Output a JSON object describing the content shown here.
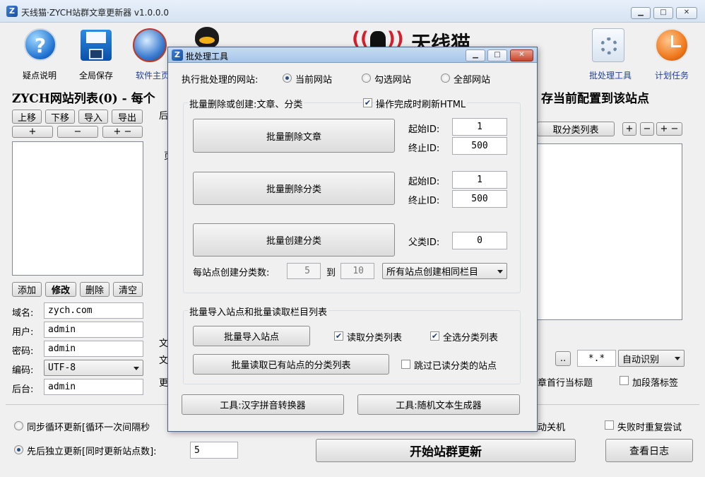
{
  "app": {
    "title": "天线猫·ZYCH站群文章更新器 v1.0.0.0",
    "brand": "天线猫",
    "min": "▁",
    "max": "□",
    "close": "✕"
  },
  "toolbar": {
    "help": "疑点说明",
    "save": "全局保存",
    "homepage": "软件主页",
    "batch": "批处理工具",
    "schedule": "计划任务"
  },
  "main": {
    "list_title": "ZYCH网站列表(0) - 每个",
    "save_to_site": "存当前配置到该站点",
    "move_up": "上移",
    "move_down": "下移",
    "import": "导入",
    "export": "导出",
    "plus": "+",
    "minus": "−",
    "plus_minus": "+ −",
    "add": "添加",
    "edit": "修改",
    "delete": "删除",
    "clear": "清空",
    "domain_label": "域名:",
    "domain": "zych.com",
    "user_label": "用户:",
    "user": "admin",
    "pwd_label": "密码:",
    "pwd": "admin",
    "enc_label": "编码:",
    "enc": "UTF-8",
    "admin_label": "后台:",
    "admin": "admin",
    "partial_hou": "后",
    "partial_ye": "页",
    "partial_wen1": "文",
    "partial_wen2": "文",
    "partial_geng": "更",
    "read_category_list": "取分类列表",
    "browse": "..",
    "wildcard": "*.*",
    "auto_detect": "自动识别",
    "first_line_title": "章首行当标题",
    "add_para_tag": "加段落标签",
    "sync_loop": "同步循环更新[循环一次间隔秒",
    "independent": "先后独立更新[同时更新站点数]:",
    "independent_count": "5",
    "auto_shutdown": "动关机",
    "retry_on_fail": "失败时重复尝试",
    "start": "开始站群更新",
    "view_log": "查看日志"
  },
  "dialog": {
    "title": "批处理工具",
    "target_label": "执行批处理的网站:",
    "target_current": "当前网站",
    "target_checked": "勾选网站",
    "target_all": "全部网站",
    "group1_title": "批量删除或创建:文章、分类",
    "refresh_html": "操作完成时刷新HTML",
    "del_articles": "批量删除文章",
    "del_categories": "批量删除分类",
    "create_categories": "批量创建分类",
    "start_id_label": "起始ID:",
    "end_id_label": "终止ID:",
    "art_start": "1",
    "art_end": "500",
    "cat_start": "1",
    "cat_end": "500",
    "parent_label": "父类ID:",
    "parent_id": "0",
    "per_site_label": "每站点创建分类数:",
    "per_site_from": "5",
    "to_label": "到",
    "per_site_to": "10",
    "mode": "所有站点创建相同栏目",
    "group2_title": "批量导入站点和批量读取栏目列表",
    "import_sites": "批量导入站点",
    "read_cat_list": "读取分类列表",
    "select_all_cat": "全选分类列表",
    "read_existing": "批量读取已有站点的分类列表",
    "skip_read": "跳过已读分类的站点",
    "tool_pinyin": "工具:汉字拼音转换器",
    "tool_random": "工具:随机文本生成器"
  }
}
